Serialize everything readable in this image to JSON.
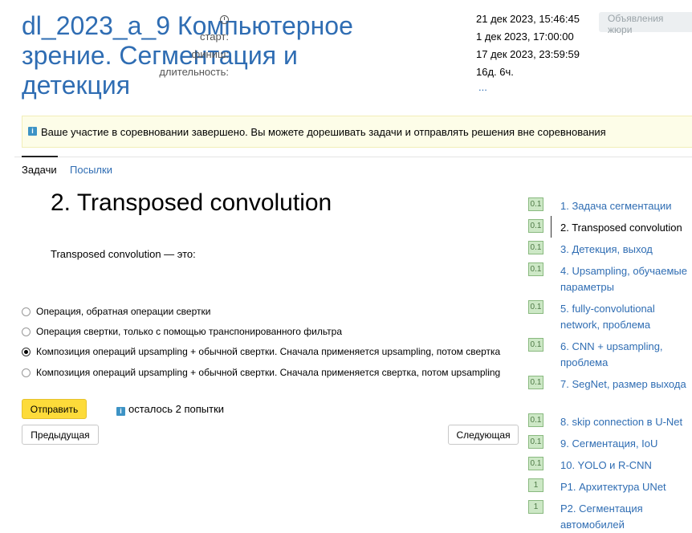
{
  "header": {
    "title": "dl_2023_a_9 Компьютерное зрение. Сегментация и детекция",
    "now": "21 дек 2023, 15:46:45",
    "start_label": "старт:",
    "start": "1 дек 2023, 17:00:00",
    "finish_label": "финиш:",
    "finish": "17 дек 2023, 23:59:59",
    "duration_label": "длительность:",
    "duration": "16д. 6ч.",
    "more": "...",
    "jury_button": "Объявления жюри"
  },
  "notice": {
    "text": "Ваше участие в соревновании завершено. Вы можете дорешивать задачи и отправлять решения вне соревнования"
  },
  "tabs": {
    "problems": "Задачи",
    "submissions": "Посылки"
  },
  "problem": {
    "title": "2. Transposed convolution",
    "question": "Transposed convolution — это:",
    "options": [
      {
        "label": "Операция, обратная операции свертки",
        "checked": false
      },
      {
        "label": "Операция свертки, только с помощью транспонированного фильтра",
        "checked": false
      },
      {
        "label": "Композиция операций upsampling + обычной свертки. Сначала применяется upsampling, потом свертка",
        "checked": true
      },
      {
        "label": "Композиция операций upsampling + обычной свертки. Сначала применяется свертка, потом upsampling",
        "checked": false
      }
    ],
    "submit": "Отправить",
    "attempts": "осталось 2 попытки",
    "prev": "Предыдущая",
    "next": "Следующая"
  },
  "problems_list": [
    {
      "score": "0.1",
      "label": "1. Задача сегментации"
    },
    {
      "score": "0.1",
      "label": "2. Transposed convolution",
      "current": true
    },
    {
      "score": "0.1",
      "label": "3. Детекция, выход"
    },
    {
      "score": "0.1",
      "label": "4. Upsampling, обучаемые параметры"
    },
    {
      "score": "0.1",
      "label": "5. fully-convolutional network, проблема"
    },
    {
      "score": "0.1",
      "label": "6. CNN + upsampling, проблема"
    },
    {
      "score": "0.1",
      "label": "7. SegNet, размер выхода"
    },
    {
      "score": "0.1",
      "label": "8. skip connection в U-Net"
    },
    {
      "score": "0.1",
      "label": "9. Сегментация, IoU"
    },
    {
      "score": "0.1",
      "label": "10. YOLO и R-CNN"
    },
    {
      "score": "1",
      "label": "P1. Архитектура UNet"
    },
    {
      "score": "1",
      "label": "P2. Сегментация автомобилей"
    }
  ]
}
